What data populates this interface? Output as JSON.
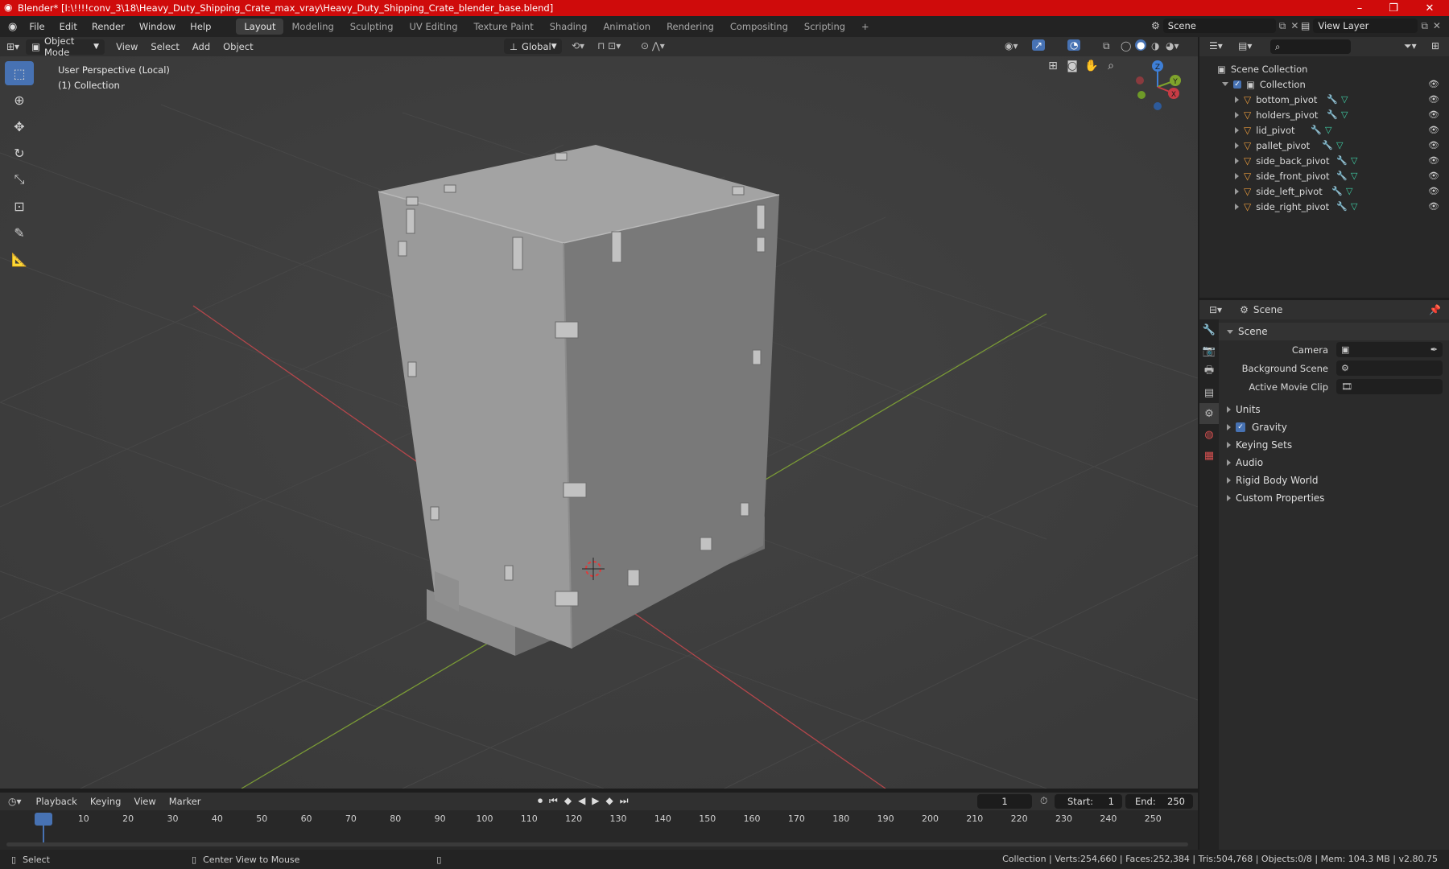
{
  "titlebar": {
    "title": "Blender* [I:\\!!!!conv_3\\18\\Heavy_Duty_Shipping_Crate_max_vray\\Heavy_Duty_Shipping_Crate_blender_base.blend]"
  },
  "menubar": {
    "menus": [
      "File",
      "Edit",
      "Render",
      "Window",
      "Help"
    ],
    "workspaces": [
      "Layout",
      "Modeling",
      "Sculpting",
      "UV Editing",
      "Texture Paint",
      "Shading",
      "Animation",
      "Rendering",
      "Compositing",
      "Scripting"
    ],
    "active_workspace": "Layout",
    "scene_name": "Scene",
    "view_layer": "View Layer"
  },
  "viewport_header": {
    "mode": "Object Mode",
    "menus": [
      "View",
      "Select",
      "Add",
      "Object"
    ],
    "orientation": "Global"
  },
  "viewport": {
    "perspective_label": "User Perspective (Local)",
    "collection_label": "(1) Collection",
    "gizmo_axes": {
      "x": "X",
      "y": "Y",
      "z": "Z"
    },
    "colors": {
      "x_axis": "#c73c45",
      "y_axis": "#7fa32c",
      "z_axis": "#3e7fd6"
    }
  },
  "outliner": {
    "root": "Scene Collection",
    "collection": "Collection",
    "items": [
      "bottom_pivot",
      "holders_pivot",
      "lid_pivot",
      "pallet_pivot",
      "side_back_pivot",
      "side_front_pivot",
      "side_left_pivot",
      "side_right_pivot"
    ]
  },
  "properties": {
    "context": "Scene",
    "section": "Scene",
    "fields": [
      {
        "label": "Camera",
        "value": ""
      },
      {
        "label": "Background Scene",
        "value": ""
      },
      {
        "label": "Active Movie Clip",
        "value": ""
      }
    ],
    "panels": [
      "Units",
      "Gravity",
      "Keying Sets",
      "Audio",
      "Rigid Body World",
      "Custom Properties"
    ],
    "gravity_enabled": true
  },
  "timeline": {
    "menus": [
      "Playback",
      "Keying",
      "View",
      "Marker"
    ],
    "current_frame": "1",
    "start_label": "Start:",
    "start": "1",
    "end_label": "End:",
    "end": "250",
    "ticks": [
      "1",
      "10",
      "20",
      "30",
      "40",
      "50",
      "60",
      "70",
      "80",
      "90",
      "100",
      "110",
      "120",
      "130",
      "140",
      "150",
      "160",
      "170",
      "180",
      "190",
      "200",
      "210",
      "220",
      "230",
      "240",
      "250"
    ]
  },
  "statusbar": {
    "select": "Select",
    "center": "Center View to Mouse",
    "stats": "Collection | Verts:254,660 | Faces:252,384 | Tris:504,768 | Objects:0/8 | Mem: 104.3 MB | v2.80.75"
  }
}
